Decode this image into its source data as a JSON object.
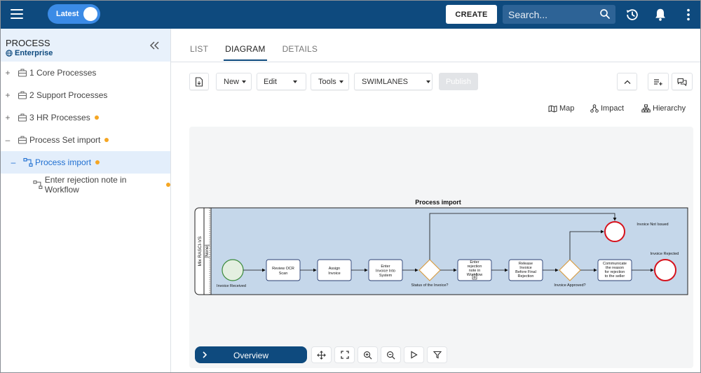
{
  "topbar": {
    "toggle_label": "Latest",
    "create_label": "CREATE",
    "search_placeholder": "Search..."
  },
  "left_panel": {
    "title": "PROCESS",
    "subtitle": "Enterprise",
    "tree": [
      {
        "expander": "+",
        "label": "1 Core Processes",
        "dot": false
      },
      {
        "expander": "+",
        "label": "2 Support Processes",
        "dot": false
      },
      {
        "expander": "+",
        "label": "3 HR Processes",
        "dot": true
      },
      {
        "expander": "–",
        "label": "Process Set import",
        "dot": true
      },
      {
        "expander": "–",
        "label": "Process import",
        "dot": true,
        "selected": true
      },
      {
        "expander": "",
        "label": "Enter rejection note in Workflow",
        "dot": true
      }
    ]
  },
  "tabs": [
    {
      "label": "LIST"
    },
    {
      "label": "DIAGRAM",
      "active": true
    },
    {
      "label": "DETAILS"
    }
  ],
  "toolbar": {
    "new_label": "New",
    "edit_label": "Edit",
    "tools_label": "Tools",
    "swimlanes_label": "SWIMLANES",
    "publish_label": "Publish"
  },
  "links": {
    "map": "Map",
    "impact": "Impact",
    "hierarchy": "Hierarchy"
  },
  "diagram": {
    "title": "Process import",
    "pool_label": "Mix RASCI-VS",
    "lane_label": "[None]",
    "start_event": "Invoice Received",
    "tasks": [
      "Review OCR Scan",
      "Assign Invoice",
      "Enter Invoice Into System",
      "Enter rejection note in Workflow",
      "Release Invoice Before Final Rejection",
      "Communicate the reason for rejection to the seller"
    ],
    "gateways": [
      "Status of the Invoice?",
      "Invoice Approved?"
    ],
    "end_events": [
      "Invoice Not Issued",
      "Invoice Rejected"
    ]
  },
  "canvas_controls": {
    "overview_label": "Overview"
  },
  "colors": {
    "topbar": "#0e4a7e",
    "lane": "#c5d7ea",
    "accent": "#1f6fd1",
    "start_event": "#3a8a3a",
    "end_event": "#d6121d",
    "gateway": "#d89a3c",
    "dot": "#f5a623"
  }
}
